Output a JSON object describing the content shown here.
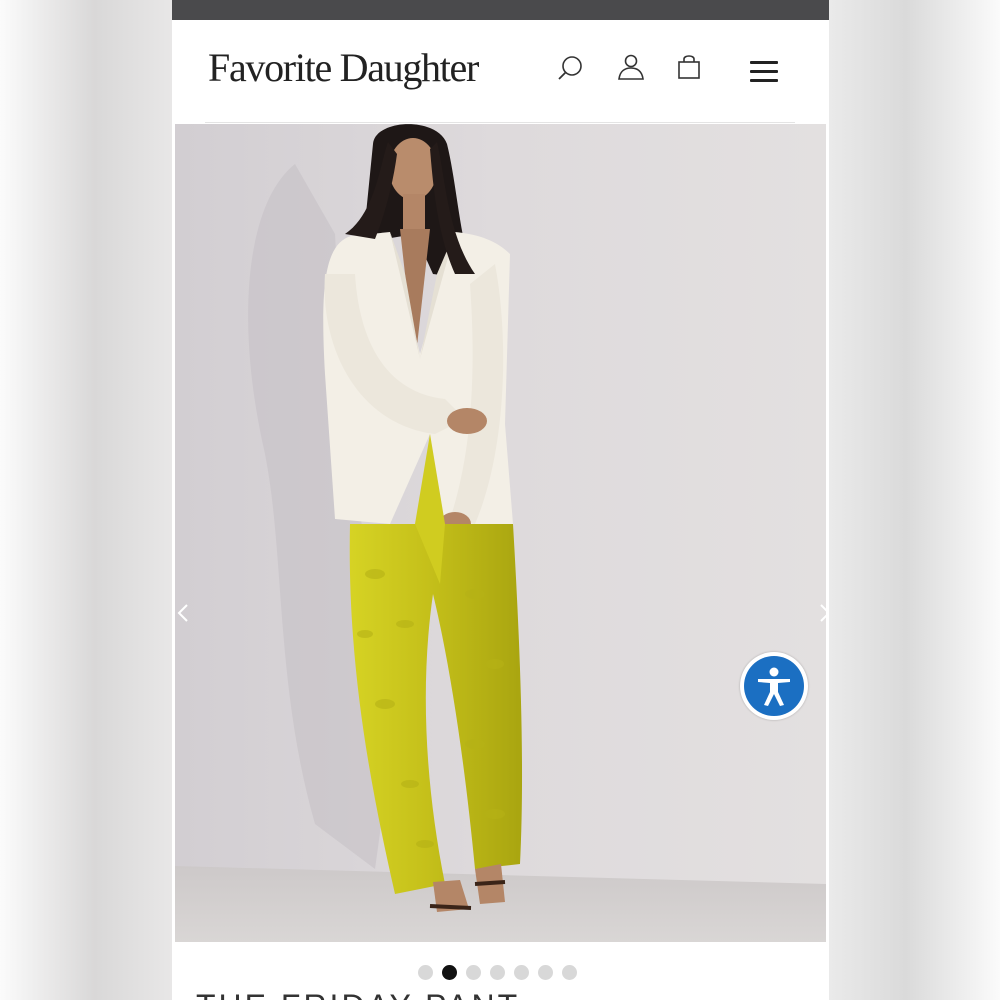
{
  "header": {
    "logo_text": "Favorite Daughter",
    "icons": [
      "search-icon",
      "account-icon",
      "shopping-bag-icon",
      "hamburger-menu-icon"
    ]
  },
  "gallery": {
    "slide_count": 7,
    "active_slide": 2,
    "prev_icon": "chevron-left-icon",
    "next_icon": "chevron-right-icon"
  },
  "accessibility": {
    "icon": "accessibility-person-icon",
    "color": "#1b6fc2"
  },
  "product": {
    "title": "THE FRIDAY PANT"
  },
  "colors": {
    "top_bar": "#4a4a4c",
    "pants": "#c8c41c",
    "blazer": "#f3efe6",
    "wall": "#dcd8da"
  }
}
